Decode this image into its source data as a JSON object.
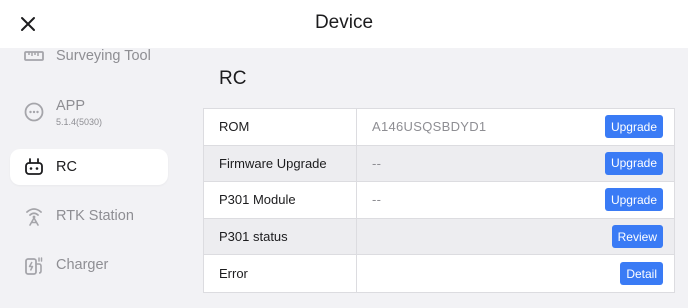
{
  "header": {
    "title": "Device",
    "close_icon": "close-icon"
  },
  "sidebar": {
    "items": [
      {
        "label": "Surveying Tool",
        "icon": "ruler-icon",
        "active": false
      },
      {
        "label": "APP",
        "sublabel": "5.1.4(5030)",
        "icon": "app-circle-icon",
        "active": false
      },
      {
        "label": "RC",
        "icon": "remote-controller-icon",
        "active": true
      },
      {
        "label": "RTK Station",
        "icon": "rtk-station-icon",
        "active": false
      },
      {
        "label": "Charger",
        "icon": "charger-icon",
        "active": false
      }
    ]
  },
  "main": {
    "section_title": "RC",
    "rows": [
      {
        "label": "ROM",
        "value": "A146USQSBDYD1",
        "button": "Upgrade"
      },
      {
        "label": "Firmware Upgrade",
        "value": "--",
        "button": "Upgrade"
      },
      {
        "label": "P301 Module",
        "value": "--",
        "button": "Upgrade"
      },
      {
        "label": "P301 status",
        "value": "",
        "button": "Review"
      },
      {
        "label": "Error",
        "value": "",
        "button": "Detail"
      }
    ]
  },
  "colors": {
    "accent": "#3a7bf5",
    "background": "#f2f2f5",
    "muted_text": "#8e8e93"
  }
}
